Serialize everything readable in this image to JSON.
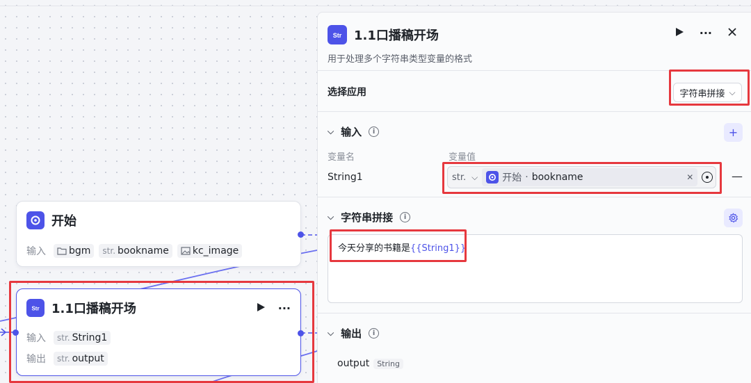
{
  "start_node": {
    "title": "开始",
    "input_label": "输入",
    "inputs": [
      {
        "prefix": "",
        "name": "bgm",
        "icon": "folder-icon"
      },
      {
        "prefix": "str.",
        "name": "bookname",
        "icon": ""
      },
      {
        "prefix": "",
        "name": "kc_image",
        "icon": "image-icon"
      }
    ]
  },
  "str_node": {
    "title": "1.1口播稿开场",
    "input_label": "输入",
    "output_label": "输出",
    "input": {
      "prefix": "str.",
      "name": "String1"
    },
    "output": {
      "prefix": "str.",
      "name": "output"
    },
    "more": "···"
  },
  "panel": {
    "title": "1.1口播稿开场",
    "description": "用于处理多个字符串类型变量的格式",
    "more": "···",
    "select_app_label": "选择应用",
    "select_app_value": "字符串拼接",
    "input_section": {
      "title": "输入",
      "col_name": "变量名",
      "col_value": "变量值",
      "var_name": "String1",
      "type": "str.",
      "ref_source": "开始",
      "ref_sep": "·",
      "ref_name": "bookname"
    },
    "concat_section": {
      "title": "字符串拼接",
      "text_plain": "今天分享的书籍是",
      "text_var": "{{String1}}"
    },
    "output_section": {
      "title": "输出",
      "name": "output",
      "type": "String"
    }
  },
  "colors": {
    "accent": "#4d53e8",
    "highlight": "#e6383e"
  }
}
